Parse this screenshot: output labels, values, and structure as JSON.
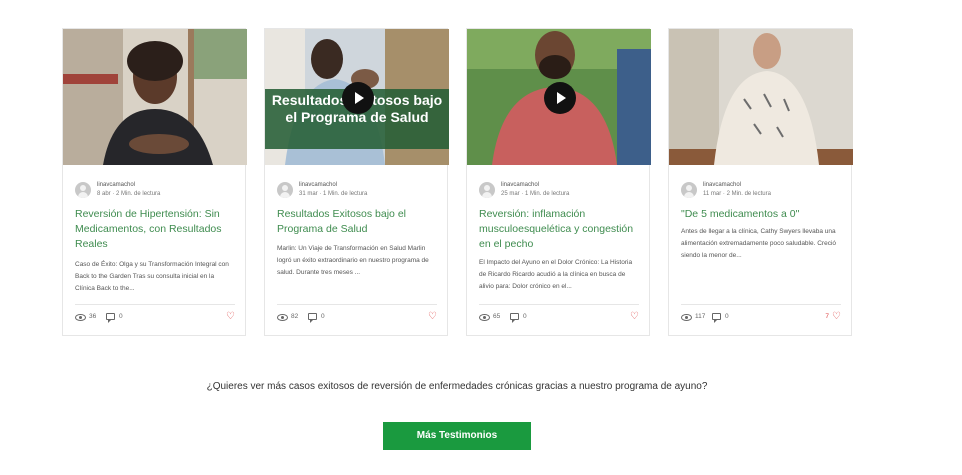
{
  "posts": [
    {
      "author": "linavcamachol",
      "date": "8 abr",
      "read_time": "2 Min. de lectura",
      "title": "Reversión de Hipertensión: Sin Medicamentos, con Resultados Reales",
      "excerpt": "Caso de Éxito: Olga y su Transformación Integral con Back to the Garden Tras su consulta inicial en la Clínica Back to the...",
      "views": "36",
      "comments": "0",
      "likes": "",
      "has_video": false,
      "overlay_title": ""
    },
    {
      "author": "linavcamachol",
      "date": "31 mar",
      "read_time": "1 Min. de lectura",
      "title": "Resultados Exitosos bajo el Programa de Salud",
      "excerpt": "Marlin: Un Viaje de Transformación en Salud Marlin logró un éxito extraordinario en nuestro programa de salud. Durante tres meses ...",
      "views": "82",
      "comments": "0",
      "likes": "",
      "has_video": true,
      "overlay_title": "Resultados Exitosos bajo el Programa de Salud"
    },
    {
      "author": "linavcamachol",
      "date": "25 mar",
      "read_time": "1 Min. de lectura",
      "title": "Reversión: inflamación musculoesquelética y congestión en el pecho",
      "excerpt": "El Impacto del Ayuno en el Dolor Crónico: La Historia de Ricardo Ricardo acudió a la clínica en busca de alivio para: Dolor crónico en el...",
      "views": "65",
      "comments": "0",
      "likes": "",
      "has_video": true,
      "overlay_title": ""
    },
    {
      "author": "linavcamachol",
      "date": "11 mar",
      "read_time": "2 Min. de lectura",
      "title": "\"De 5 medicamentos a 0\"",
      "excerpt": "Antes de llegar a la clínica, Cathy Swyers llevaba una alimentación extremadamente poco saludable. Creció siendo la menor de...",
      "views": "117",
      "comments": "0",
      "likes": "7",
      "has_video": false,
      "overlay_title": ""
    }
  ],
  "cta": {
    "text": "¿Quieres ver más casos exitosos de reversión de enfermedades crónicas gracias a nuestro programa de ayuno?",
    "button_label": "Más Testimonios"
  },
  "colors": {
    "title_green": "#3f8c4f",
    "button_green": "#1a9a3f",
    "heart_red": "#d44444",
    "overlay_green": "#265e36"
  }
}
